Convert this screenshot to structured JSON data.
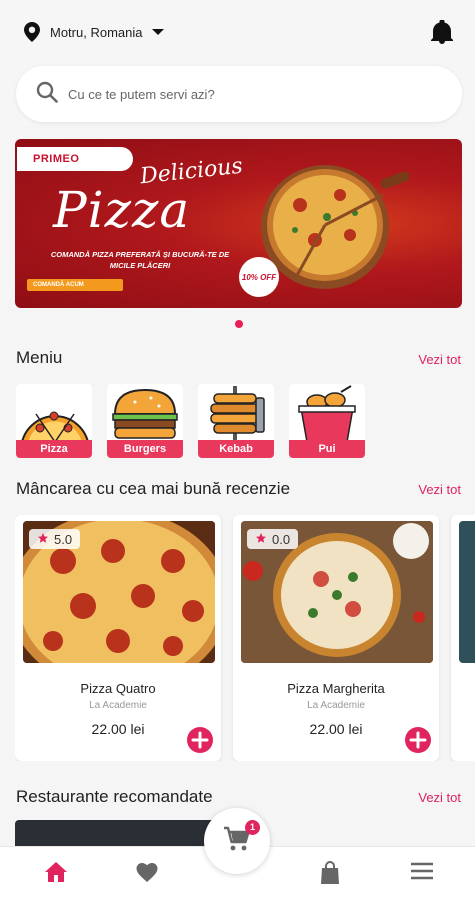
{
  "header": {
    "location": "Motru, Romania",
    "location_icon": "map-pin-icon",
    "dropdown_icon": "caret-down-icon",
    "notification_icon": "bell-icon"
  },
  "search": {
    "placeholder": "Cu ce te putem servi azi?",
    "icon": "search-icon"
  },
  "banner": {
    "brand": "PRIMEO",
    "headline_small": "Delicious",
    "headline_big": "Pizza",
    "tagline": "COMANDĂ PIZZA PREFERATĂ ȘI BUCURĂ-TE DE MICILE PLĂCERI",
    "button": "COMANDĂ ACUM",
    "badge": "10% OFF",
    "background_color": "#b0181c"
  },
  "menu": {
    "title": "Meniu",
    "see_all": "Vezi tot",
    "categories": [
      {
        "label": "Pizza",
        "icon": "pizza-icon"
      },
      {
        "label": "Burgers",
        "icon": "burger-icon"
      },
      {
        "label": "Kebab",
        "icon": "kebab-icon"
      },
      {
        "label": "Pui",
        "icon": "chicken-bucket-icon"
      }
    ]
  },
  "top_rated": {
    "title": "Mâncarea cu cea mai bună recenzie",
    "see_all": "Vezi tot",
    "items": [
      {
        "rating": "5.0",
        "name": "Pizza Quatro",
        "restaurant": "La Academie",
        "price": "22.00 lei"
      },
      {
        "rating": "0.0",
        "name": "Pizza Margherita",
        "restaurant": "La Academie",
        "price": "22.00 lei"
      }
    ]
  },
  "restaurants": {
    "title": "Restaurante recomandate",
    "see_all": "Vezi tot"
  },
  "bottom_nav": {
    "items": [
      "home-icon",
      "heart-icon",
      "bag-icon",
      "menu-icon"
    ],
    "cart_icon": "cart-icon",
    "cart_count": "1"
  },
  "colors": {
    "accent": "#e0245e",
    "category_label_bg": "#e8385c"
  }
}
